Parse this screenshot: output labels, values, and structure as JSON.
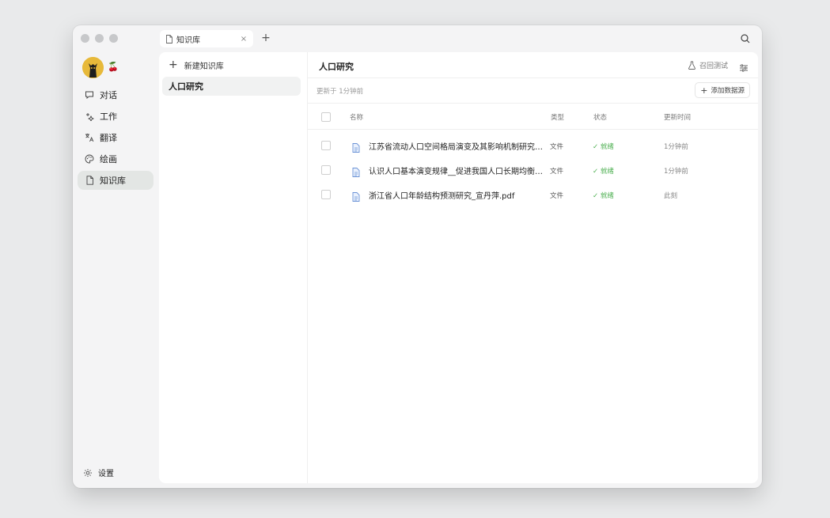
{
  "tab": {
    "label": "知识库",
    "close": "×",
    "new": "+"
  },
  "sidebar": {
    "items": [
      {
        "label": "对话",
        "icon": "chat-icon"
      },
      {
        "label": "工作",
        "icon": "sparkle-icon"
      },
      {
        "label": "翻译",
        "icon": "translate-icon"
      },
      {
        "label": "绘画",
        "icon": "palette-icon"
      },
      {
        "label": "知识库",
        "icon": "document-icon",
        "active": true
      }
    ],
    "settings_label": "设置",
    "cherry": "🍒"
  },
  "kb": {
    "new_label": "新建知识库",
    "new_plus": "+",
    "items": [
      "人口研究"
    ]
  },
  "content": {
    "title": "人口研究",
    "recall_label": "召回测试",
    "updated": "更新于 1分钟前",
    "add_source_label": "添加数据源",
    "add_plus": "+",
    "columns": {
      "name": "名称",
      "type": "类型",
      "status": "状态",
      "time": "更新时间"
    },
    "rows": [
      {
        "name": "江苏省流动人口空间格局演变及其影响机制研究.pdf",
        "type": "文件",
        "status": "✓ 就绪",
        "time": "1分钟前"
      },
      {
        "name": "认识人口基本演变规律__促进我国人口长期均衡发展.pdf",
        "type": "文件",
        "status": "✓ 就绪",
        "time": "1分钟前"
      },
      {
        "name": "浙江省人口年龄结构预测研究_宣丹萍.pdf",
        "type": "文件",
        "status": "✓ 就绪",
        "time": "此刻"
      }
    ]
  },
  "colors": {
    "accent_green": "#4caf50",
    "active_bg": "#e3e6e4",
    "avatar_bg": "#e7b93a"
  }
}
